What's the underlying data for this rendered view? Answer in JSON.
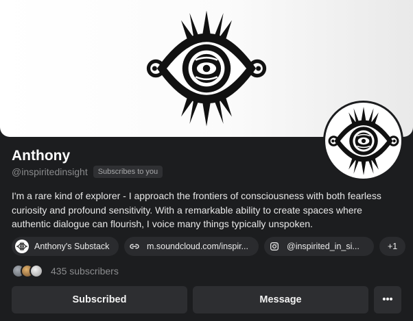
{
  "profile": {
    "name": "Anthony",
    "handle": "@inspiritedinsight",
    "badge": "Subscribes to you",
    "bio": "I'm a rare kind of explorer - I approach the frontiers of consciousness with both fearless curiosity and profound sensitivity. With a remarkable ability to create spaces where authentic dialogue can flourish, I voice many things typically unspoken."
  },
  "links": [
    {
      "label": "Anthony's Substack",
      "icon": "eye-logo-icon"
    },
    {
      "label": "m.soundcloud.com/inspir...",
      "icon": "link-icon"
    },
    {
      "label": "@inspirited_in_si...",
      "icon": "instagram-icon"
    }
  ],
  "more_links": "+1",
  "subscribers": {
    "text": "435 subscribers",
    "avatar_colors": [
      "#7a7f86",
      "#b58a55",
      "#d8d8d8"
    ]
  },
  "actions": {
    "subscribed": "Subscribed",
    "message": "Message",
    "more": "•••"
  },
  "colors": {
    "background": "#1c1d1f",
    "chip": "#2a2b2e",
    "button": "#2d2e31",
    "muted_text": "#8a8b8d"
  }
}
